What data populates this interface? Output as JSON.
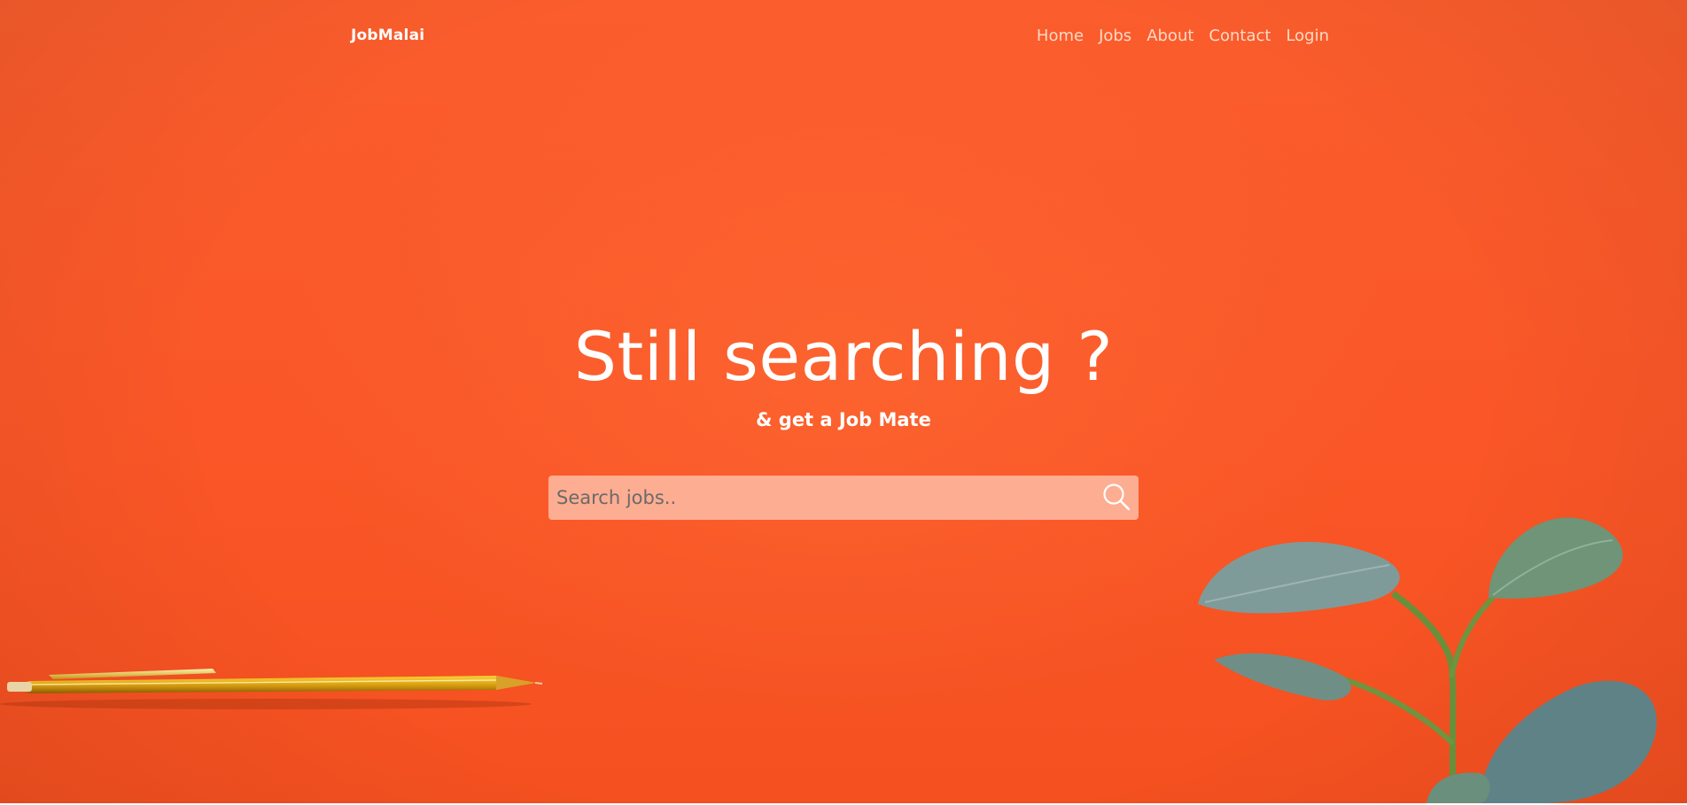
{
  "brand": {
    "name": "JobMalai"
  },
  "nav": {
    "items": [
      {
        "label": "Home"
      },
      {
        "label": "Jobs"
      },
      {
        "label": "About"
      },
      {
        "label": "Contact"
      },
      {
        "label": "Login"
      }
    ]
  },
  "hero": {
    "headline": "Still searching ?",
    "tagline": "& get a Job Mate"
  },
  "search": {
    "placeholder": "Search jobs..",
    "value": "",
    "icon": "search-icon"
  },
  "colors": {
    "background": "#fa5627",
    "text": "#ffffff",
    "nav_link": "#ffd9c6"
  }
}
